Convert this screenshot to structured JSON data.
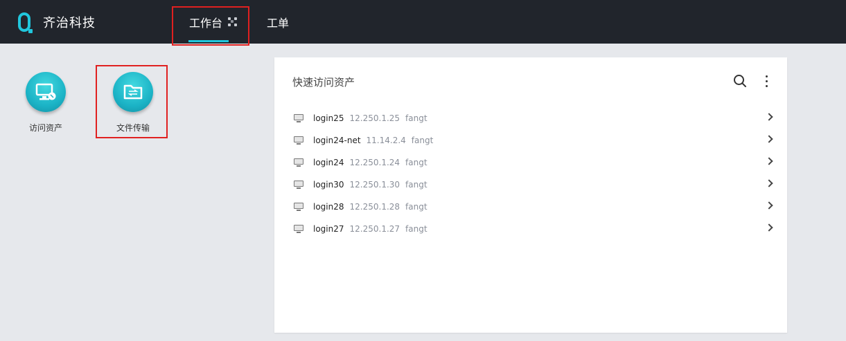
{
  "header": {
    "brand": "齐治科技",
    "tabs": [
      {
        "label": "工作台"
      },
      {
        "label": "工单"
      }
    ]
  },
  "apps": [
    {
      "label": "访问资产",
      "icon": "monitor-icon"
    },
    {
      "label": "文件传输",
      "icon": "folder-transfer-icon"
    }
  ],
  "quick_access": {
    "title": "快速访问资产",
    "assets": [
      {
        "name": "login25",
        "ip": "12.250.1.25",
        "user": "fangt"
      },
      {
        "name": "login24-net",
        "ip": "11.14.2.4",
        "user": "fangt"
      },
      {
        "name": "login24",
        "ip": "12.250.1.24",
        "user": "fangt"
      },
      {
        "name": "login30",
        "ip": "12.250.1.30",
        "user": "fangt"
      },
      {
        "name": "login28",
        "ip": "12.250.1.28",
        "user": "fangt"
      },
      {
        "name": "login27",
        "ip": "12.250.1.27",
        "user": "fangt"
      }
    ]
  },
  "colors": {
    "topbar": "#21252c",
    "accent": "#21c6dc",
    "highlight": "#e02020"
  }
}
